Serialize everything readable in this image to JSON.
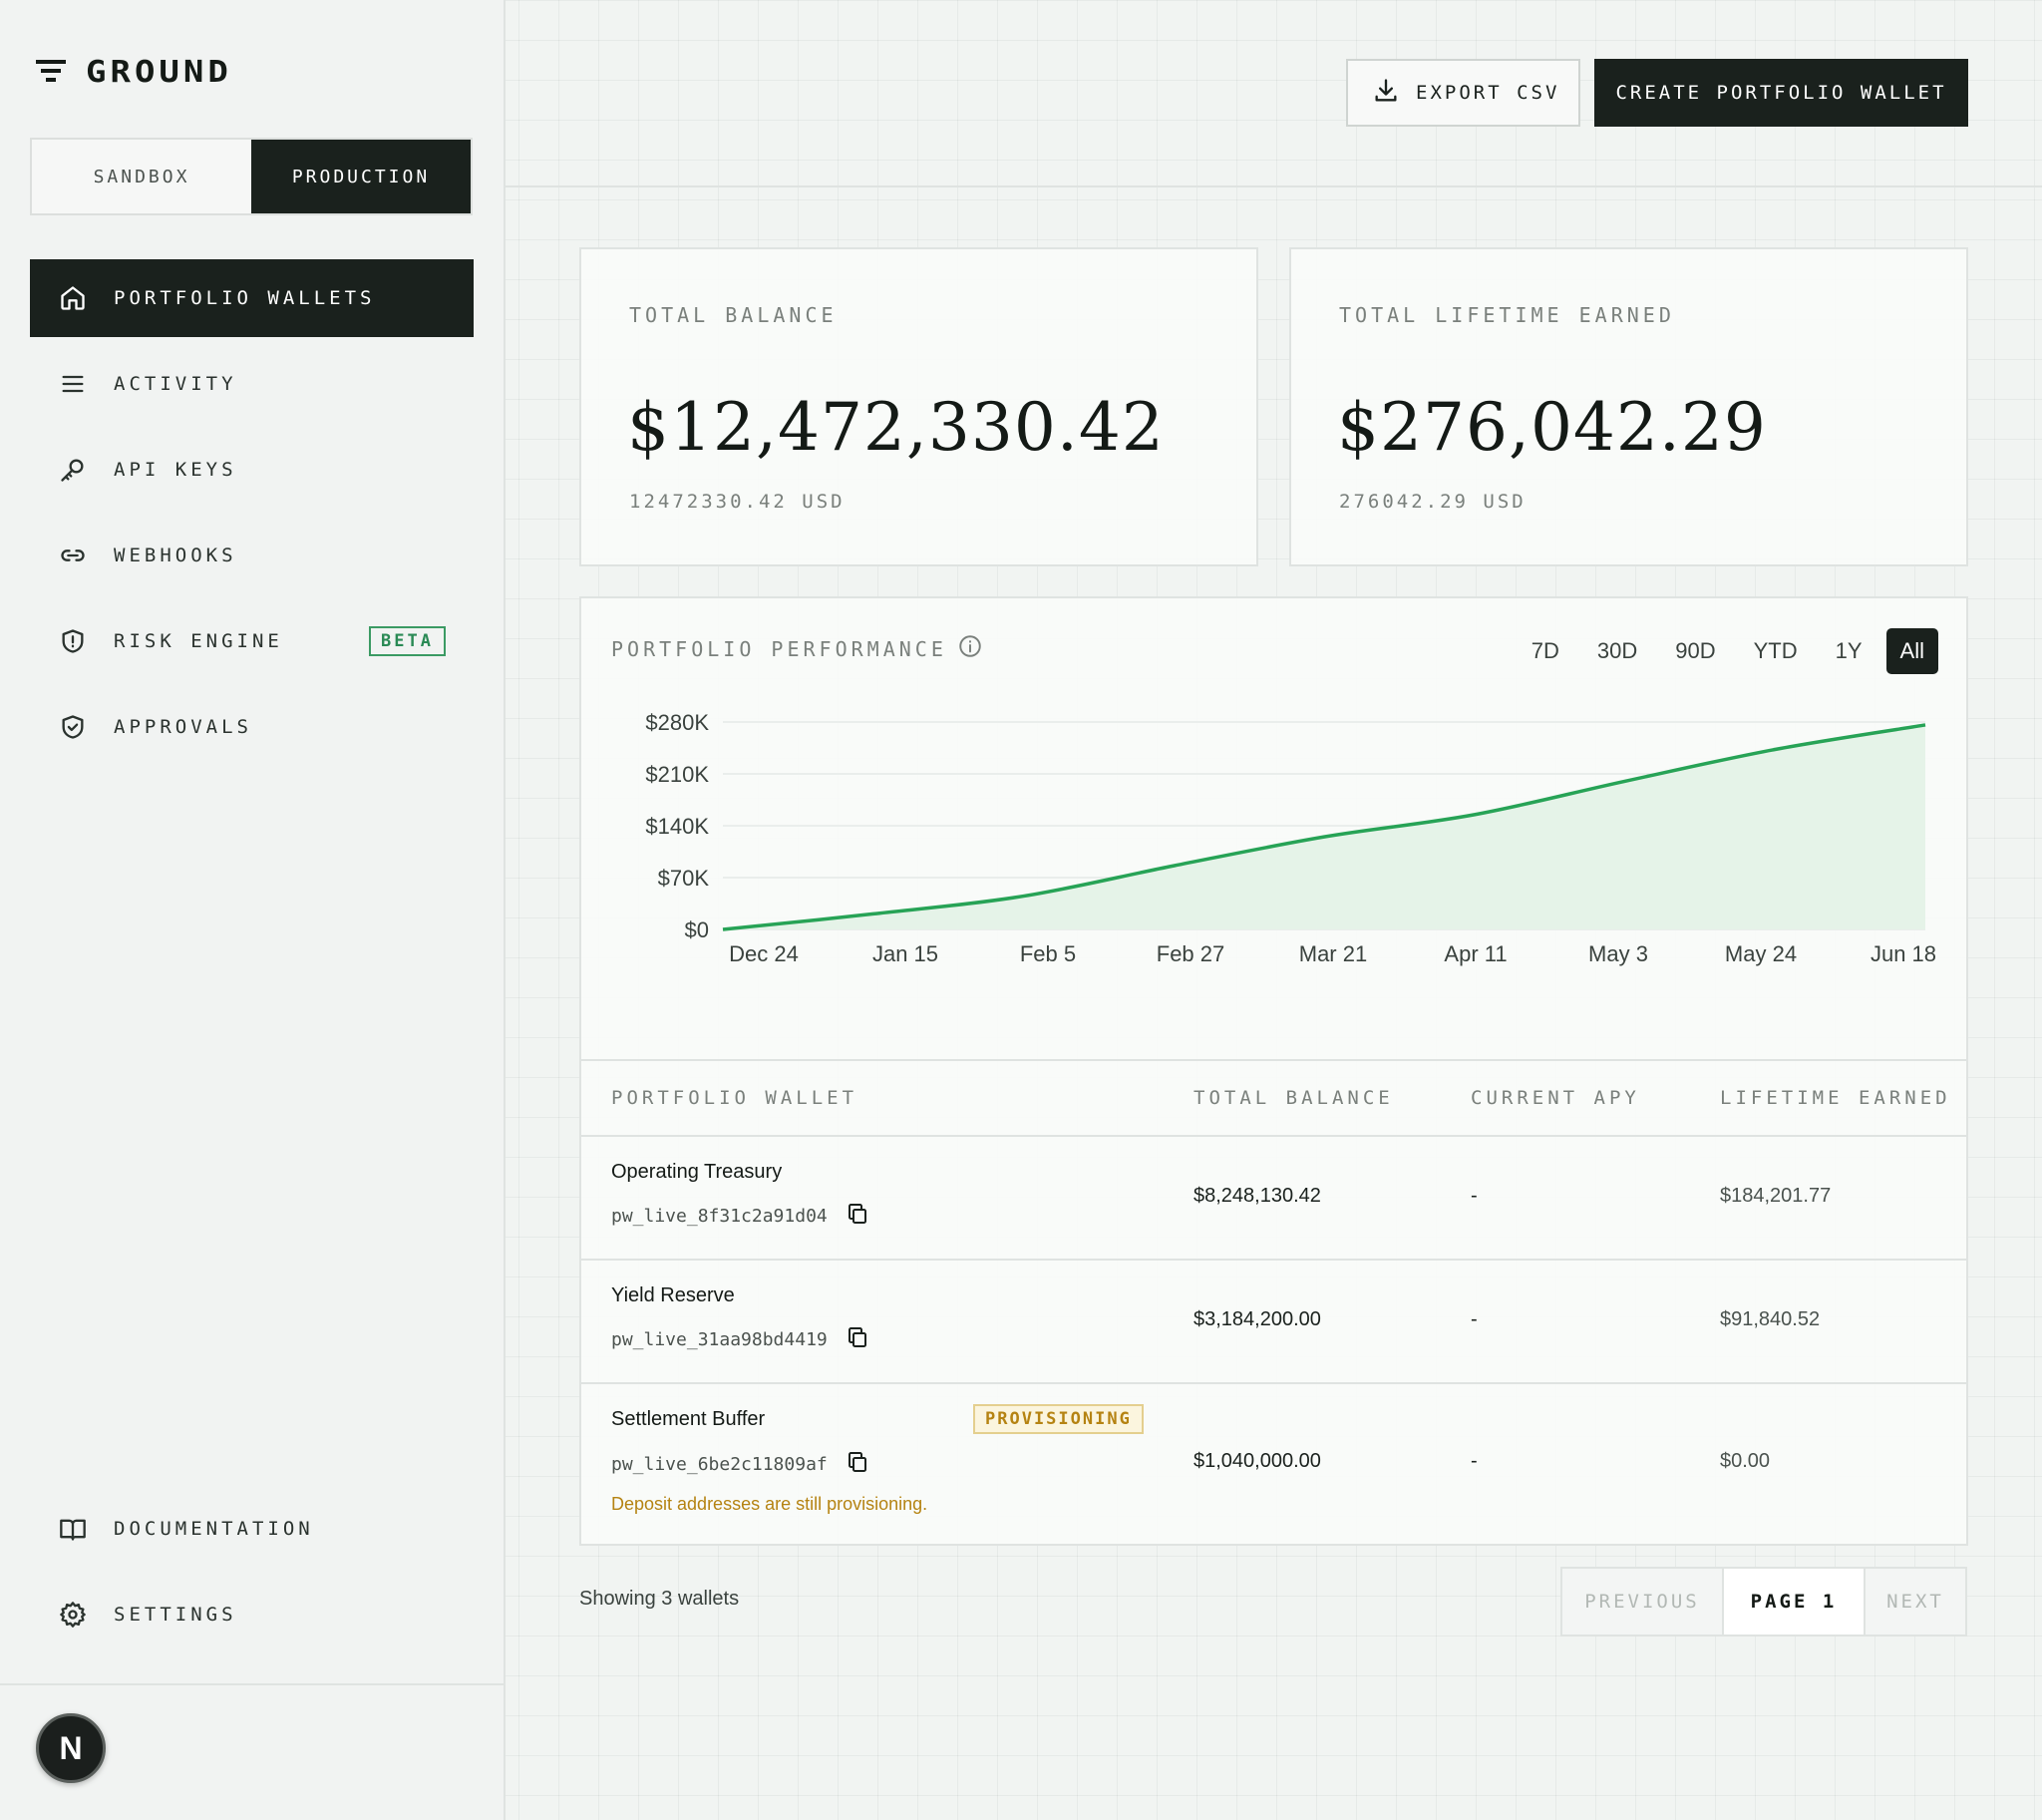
{
  "app": {
    "logo_text": "GROUND"
  },
  "environment": {
    "options": [
      "SANDBOX",
      "PRODUCTION"
    ],
    "selected": "PRODUCTION"
  },
  "sidebar": {
    "items": [
      {
        "label": "PORTFOLIO WALLETS",
        "icon": "home-icon",
        "active": true
      },
      {
        "label": "ACTIVITY",
        "icon": "list-icon"
      },
      {
        "label": "API KEYS",
        "icon": "key-icon"
      },
      {
        "label": "WEBHOOKS",
        "icon": "link-icon"
      },
      {
        "label": "RISK ENGINE",
        "icon": "shield-alert-icon",
        "badge": "BETA"
      },
      {
        "label": "APPROVALS",
        "icon": "shield-check-icon"
      }
    ],
    "bottom_items": [
      {
        "label": "DOCUMENTATION",
        "icon": "book-icon"
      },
      {
        "label": "SETTINGS",
        "icon": "gear-icon"
      }
    ],
    "avatar_initial": "N"
  },
  "header": {
    "export_label": "EXPORT CSV",
    "create_label": "CREATE PORTFOLIO WALLET"
  },
  "stats": {
    "total_balance": {
      "label": "TOTAL BALANCE",
      "value": "$12,472,330.42",
      "sub": "12472330.42 USD"
    },
    "lifetime_earned": {
      "label": "TOTAL LIFETIME EARNED",
      "value": "$276,042.29",
      "sub": "276042.29 USD"
    }
  },
  "performance": {
    "title": "PORTFOLIO PERFORMANCE",
    "ranges": [
      "7D",
      "30D",
      "90D",
      "YTD",
      "1Y",
      "All"
    ],
    "selected_range": "All"
  },
  "colors": {
    "accent": "#27a356",
    "fill": "#e5f3e8",
    "dark": "#1a211d",
    "warning": "#b58312"
  },
  "chart_data": {
    "type": "area",
    "y_ticks": [
      "$280K",
      "$210K",
      "$140K",
      "$70K",
      "$0"
    ],
    "x_ticks": [
      "Dec 24",
      "Jan 15",
      "Feb 5",
      "Feb 27",
      "Mar 21",
      "Apr 11",
      "May 3",
      "May 24",
      "Jun 18"
    ],
    "ylim": [
      0,
      280000
    ],
    "x": [
      "Dec 24",
      "Jan 15",
      "Feb 5",
      "Feb 27",
      "Mar 21",
      "Apr 11",
      "May 3",
      "May 24",
      "Jun 18"
    ],
    "values": [
      0,
      21000,
      45000,
      86000,
      125000,
      155000,
      200000,
      243000,
      276042
    ],
    "grid": true
  },
  "table": {
    "headers": [
      "PORTFOLIO WALLET",
      "TOTAL BALANCE",
      "CURRENT APY",
      "LIFETIME EARNED"
    ],
    "rows": [
      {
        "name": "Operating Treasury",
        "id": "pw_live_8f31c2a91d04",
        "balance": "$8,248,130.42",
        "apy": "-",
        "earned": "$184,201.77"
      },
      {
        "name": "Yield Reserve",
        "id": "pw_live_31aa98bd4419",
        "balance": "$3,184,200.00",
        "apy": "-",
        "earned": "$91,840.52"
      },
      {
        "name": "Settlement Buffer",
        "id": "pw_live_6be2c11809af",
        "balance": "$1,040,000.00",
        "apy": "-",
        "earned": "$0.00",
        "badge": "PROVISIONING",
        "note": "Deposit addresses are still provisioning."
      }
    ]
  },
  "footer": {
    "showing": "Showing 3 wallets",
    "prev_label": "PREVIOUS",
    "page_label": "PAGE 1",
    "next_label": "NEXT"
  }
}
